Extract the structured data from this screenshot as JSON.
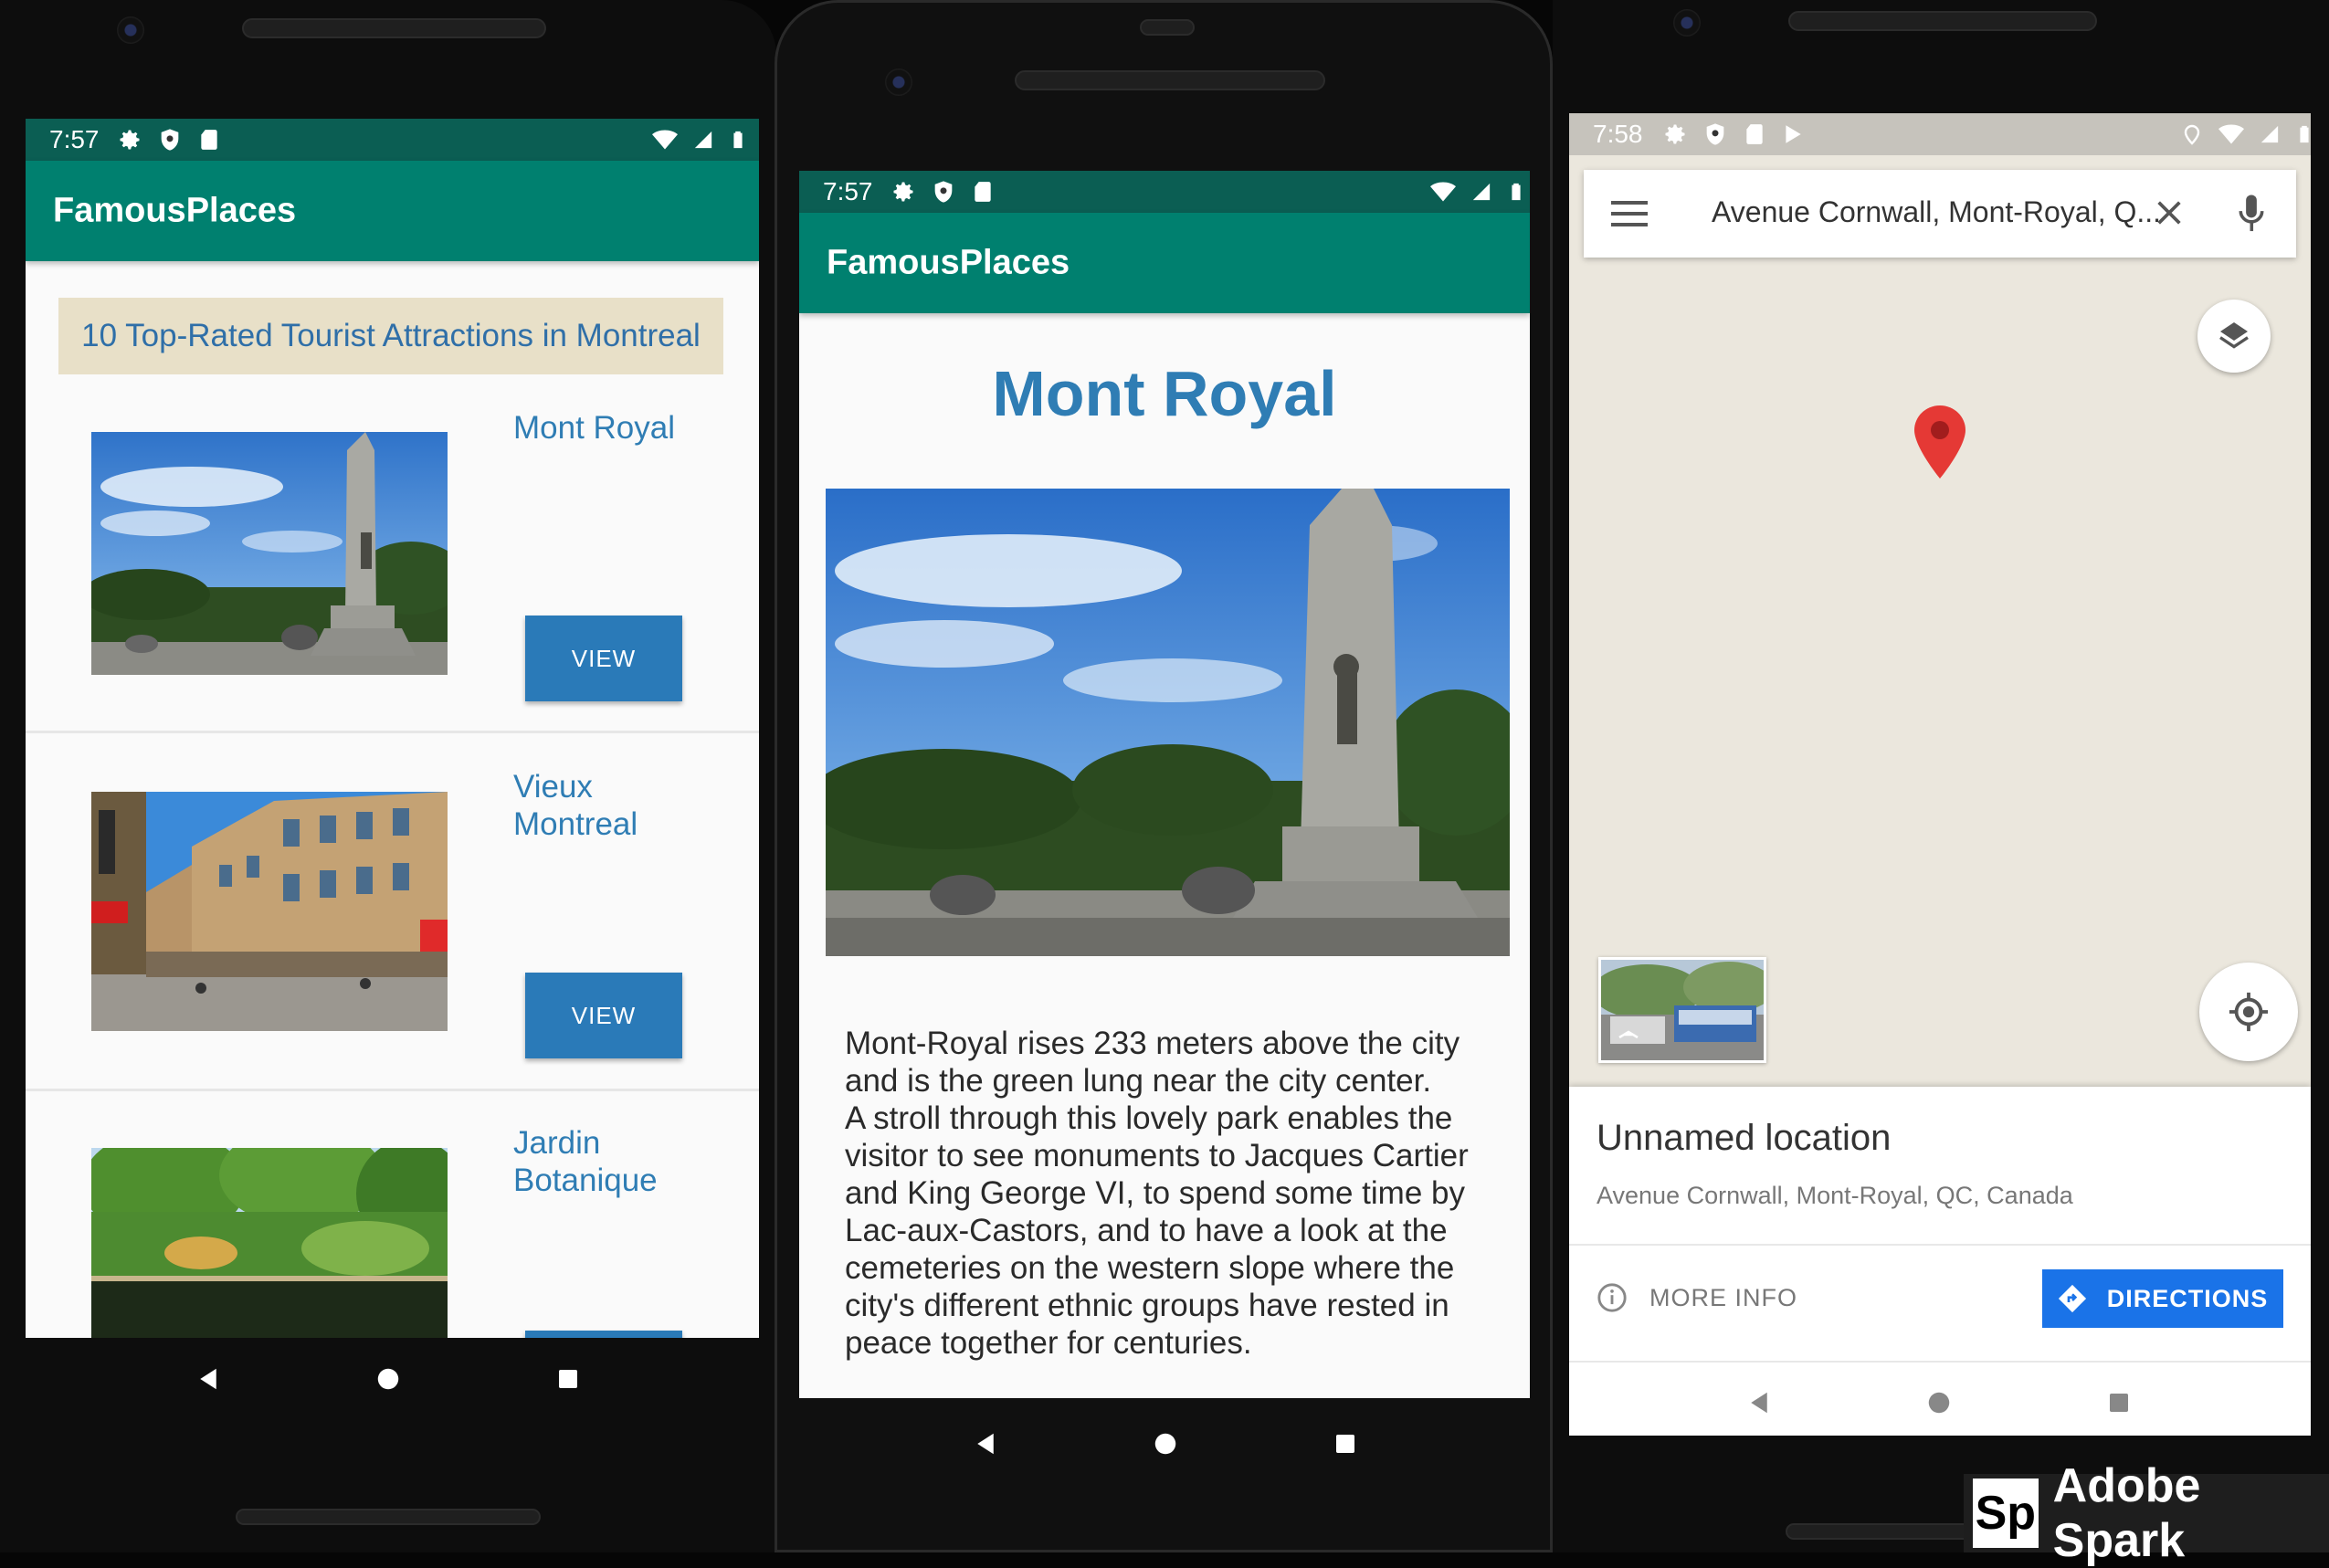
{
  "phone1": {
    "status_time": "7:57",
    "app_title": "FamousPlaces",
    "banner": "10 Top-Rated Tourist Attractions in Montreal",
    "places": [
      {
        "name": "Mont Royal",
        "button": "VIEW"
      },
      {
        "name": "Vieux Montreal",
        "button": "VIEW"
      },
      {
        "name": "Jardin Botanique",
        "button": ""
      }
    ]
  },
  "phone2": {
    "status_time": "7:57",
    "app_title": "FamousPlaces",
    "title": "Mont Royal",
    "description": [
      "Mont-Royal rises 233 meters above the city",
      "and is the green lung near the city center.",
      "A stroll through this lovely park enables the",
      "visitor to see monuments to Jacques Cartier",
      "and King George VI, to spend some time by",
      "Lac-aux-Castors, and to have a look at the",
      "cemeteries on the western slope where the",
      "city's different ethnic groups have rested in",
      "peace together for centuries."
    ]
  },
  "phone3": {
    "status_time": "7:58",
    "search_value": "Avenue Cornwall, Mont-Royal, Q...",
    "place_title": "Unnamed location",
    "place_address": "Avenue Cornwall, Mont-Royal, QC, Canada",
    "more_info": "MORE INFO",
    "directions": "DIRECTIONS"
  },
  "watermark": {
    "logo": "Sp",
    "text": "Adobe Spark"
  },
  "colors": {
    "app_bar": "#00806f",
    "status_bar": "#0b5e53",
    "link_blue": "#2f7db4",
    "button_blue": "#2a7ab8",
    "directions_blue": "#1a73e8",
    "map_bg": "#ebe7dd",
    "pin_red": "#e53935"
  },
  "icons": {
    "status": [
      "gear-icon",
      "shield-icon",
      "sd-card-icon",
      "wifi-icon",
      "signal-icon",
      "battery-icon"
    ],
    "nav": [
      "back-icon",
      "home-icon",
      "recents-icon"
    ],
    "map": [
      "menu-icon",
      "close-icon",
      "mic-icon",
      "layers-icon",
      "location-pin-icon",
      "my-location-icon",
      "info-icon",
      "directions-icon"
    ]
  }
}
